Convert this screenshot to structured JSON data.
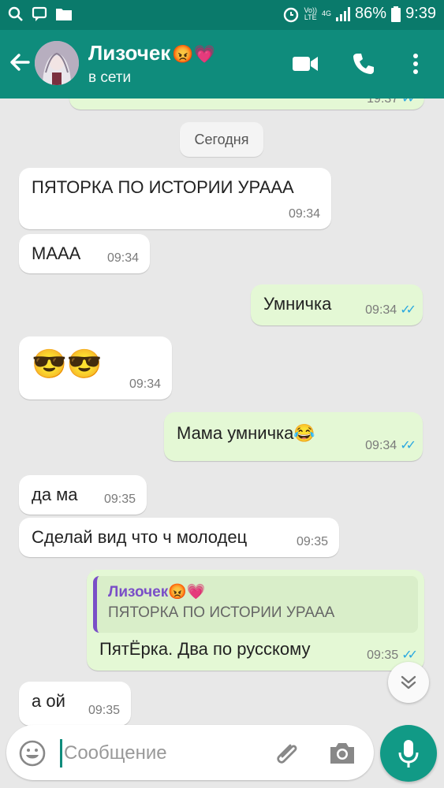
{
  "status_bar": {
    "icons": [
      "search-icon",
      "chat-bubble-icon",
      "folder-icon"
    ],
    "alarm_icon": "alarm-icon",
    "network_top": "Vo))",
    "network_bottom": "LTE",
    "network_gen": "4G",
    "battery": "86%",
    "time": "9:39",
    "bg_color": "#0a7a6b"
  },
  "header": {
    "name": "Лизочек",
    "name_emoji": "😡💗",
    "status": "в сети",
    "bg_color": "#0f8c7c",
    "icons": [
      "back-arrow-icon",
      "video-call-icon",
      "phone-icon",
      "more-vert-icon"
    ]
  },
  "chat": {
    "date_chip": "Сегодня",
    "partial_time": "19:37",
    "messages": [
      {
        "dir": "in",
        "text": "ПЯТОРКА ПО ИСТОРИИ УРААА",
        "time": "09:34"
      },
      {
        "dir": "in",
        "text": "МААА",
        "time": "09:34"
      },
      {
        "dir": "out",
        "text": "Умничка",
        "time": "09:34",
        "ticks": "✓✓"
      },
      {
        "dir": "in",
        "text": "😎😎",
        "time": "09:34"
      },
      {
        "dir": "out",
        "text": "Мама умничка😂",
        "time": "09:34",
        "ticks": "✓✓"
      },
      {
        "dir": "in",
        "text": "да ма",
        "time": "09:35"
      },
      {
        "dir": "in",
        "text": "Сделай вид что ч молодец",
        "time": "09:35"
      },
      {
        "dir": "out",
        "reply_name": "Лизочек😡💗",
        "reply_text": "ПЯТОРКА ПО ИСТОРИИ УРААА",
        "text": "ПятЁрка. Два по русскому",
        "time": "09:35",
        "ticks": "✓✓"
      },
      {
        "dir": "in",
        "text": "а ой",
        "time": "09:35"
      }
    ],
    "incoming_color": "#ffffff",
    "outgoing_color": "#e4f8d5",
    "tick_color": "#2aa8e0"
  },
  "composer": {
    "placeholder": "Сообщение",
    "value": "",
    "icons": [
      "emoji-icon",
      "attach-icon",
      "camera-icon",
      "mic-icon",
      "chevron-down-icon"
    ]
  }
}
